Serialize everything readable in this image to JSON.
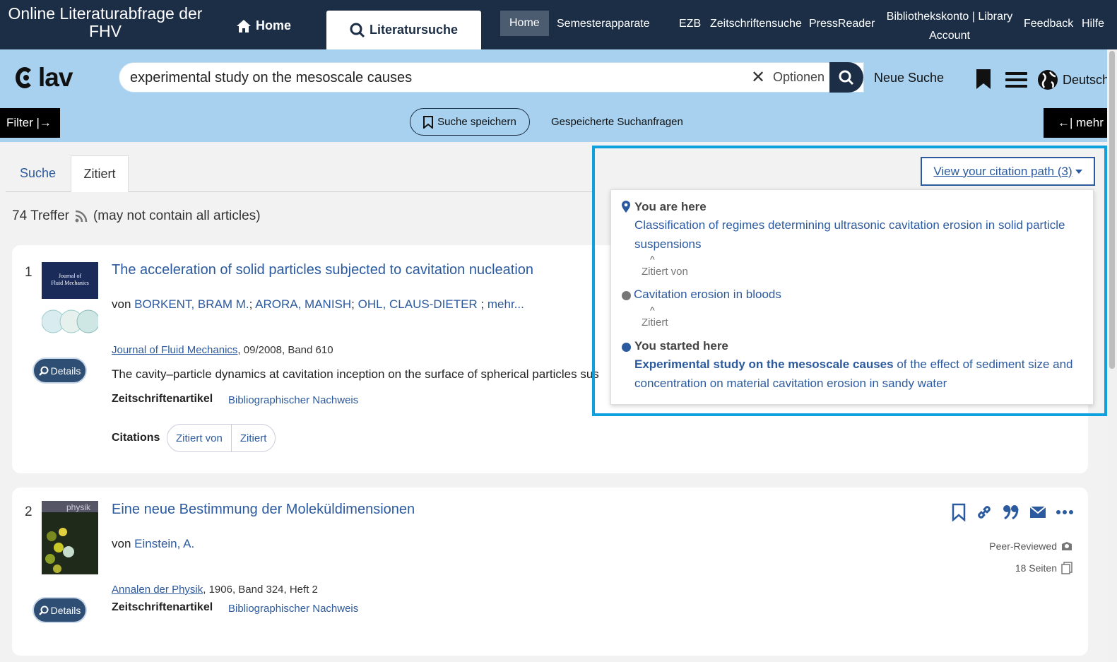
{
  "topnav": {
    "site_title": "Online Literaturabfrage der FHV",
    "home_tab": "Home",
    "lit_tab": "Literatursuche",
    "links": [
      "Home",
      "Semesterapparate",
      "EZB",
      "Zeitschriftensuche",
      "PressReader"
    ],
    "account_line1": "Bibliothekskonto | Library",
    "account_line2": "Account",
    "feedback": "Feedback",
    "help": "Hilfe"
  },
  "search": {
    "logo_text": "lav",
    "query": "experimental study on the mesoscale causes",
    "options_label": "Optionen",
    "new_search": "Neue Suche",
    "language": "Deutsch",
    "filter_label": "Filter |→",
    "more_label": "←| mehr",
    "save_search": "Suche speichern",
    "saved_queries": "Gespeicherte Suchanfragen"
  },
  "tabs": {
    "search": "Suche",
    "cited": "Zitiert"
  },
  "results_summary": {
    "count": "74 Treffer",
    "note": "(may not contain all articles)"
  },
  "results": [
    {
      "num": "1",
      "title": "The acceleration of solid particles subjected to cavitation nucleation",
      "by": "von",
      "authors": [
        "BORKENT, BRAM M.",
        "ARORA, MANISH",
        "OHL, CLAUS-DIETER"
      ],
      "more": "mehr...",
      "journal": "Journal of Fluid Mechanics",
      "source_rest": ", 09/2008, Band 610",
      "abstract": "The cavity–particle dynamics at cavitation inception on the surface of spherical particles sus",
      "type": "Zeitschriftenartikel",
      "biblio": "Bibliographischer Nachweis",
      "details": "Details",
      "citations_label": "Citations",
      "cited_by": "Zitiert von",
      "cites": "Zitiert",
      "cover_title": "Journal of Fluid Mechanics"
    },
    {
      "num": "2",
      "title": "Eine neue Bestimmung der Moleküldimensionen",
      "by": "von",
      "authors": [
        "Einstein, A."
      ],
      "journal": "Annalen der Physik",
      "source_rest": ", 1906, Band 324, Heft 2",
      "type": "Zeitschriftenartikel",
      "biblio": "Bibliographischer Nachweis",
      "details": "Details",
      "peer": "Peer-Reviewed",
      "pages": "18 Seiten",
      "cover_title": "physik"
    }
  ],
  "citation_path": {
    "button": "View your citation path (3)",
    "you_are_here": "You are here",
    "current_title": "Classification of regimes determining ultrasonic cavitation erosion in solid particle suspensions",
    "rel1": "Zitiert von",
    "middle_title": "Cavitation erosion in bloods",
    "rel2": "Zitiert",
    "started_here": "You started here",
    "start_title_bold": "Experimental study on the mesoscale causes",
    "start_title_rest": " of the effect of sediment size and concentration on material cavitation erosion in sandy water"
  },
  "colors": {
    "nav": "#1c2e45",
    "band": "#a7d1ef",
    "link": "#2c5a9e",
    "highlight": "#0fa0de"
  }
}
